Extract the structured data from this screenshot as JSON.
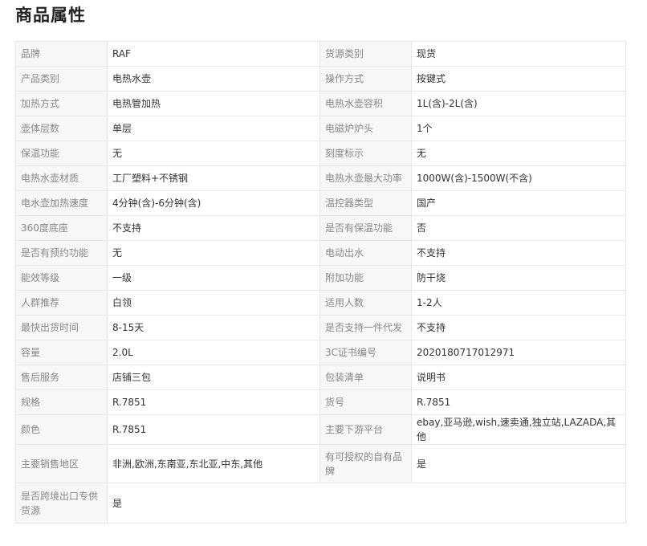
{
  "title": "商品属性",
  "rows": [
    {
      "k1": "品牌",
      "v1": "RAF",
      "k2": "货源类别",
      "v2": "现货"
    },
    {
      "k1": "产品类别",
      "v1": "电热水壶",
      "k2": "操作方式",
      "v2": "按键式"
    },
    {
      "k1": "加热方式",
      "v1": "电热管加热",
      "k2": "电热水壶容积",
      "v2": "1L(含)-2L(含)"
    },
    {
      "k1": "壶体层数",
      "v1": "单层",
      "k2": "电磁炉炉头",
      "v2": "1个"
    },
    {
      "k1": "保温功能",
      "v1": "无",
      "k2": "刻度标示",
      "v2": "无"
    },
    {
      "k1": "电热水壶材质",
      "v1": "工厂塑料+不锈钢",
      "k2": "电热水壶最大功率",
      "v2": "1000W(含)-1500W(不含)"
    },
    {
      "k1": "电水壶加热速度",
      "v1": "4分钟(含)-6分钟(含)",
      "k2": "温控器类型",
      "v2": "国产"
    },
    {
      "k1": "360度底座",
      "v1": "不支持",
      "k2": "是否有保温功能",
      "v2": "否"
    },
    {
      "k1": "是否有预约功能",
      "v1": "无",
      "k2": "电动出水",
      "v2": "不支持"
    },
    {
      "k1": "能效等级",
      "v1": "一级",
      "k2": "附加功能",
      "v2": "防干烧"
    },
    {
      "k1": "人群推荐",
      "v1": "白领",
      "k2": "适用人数",
      "v2": "1-2人"
    },
    {
      "k1": "最快出货时间",
      "v1": "8-15天",
      "k2": "是否支持一件代发",
      "v2": "不支持"
    },
    {
      "k1": "容量",
      "v1": "2.0L",
      "k2": "3C证书编号",
      "v2": "2020180717012971"
    },
    {
      "k1": "售后服务",
      "v1": "店铺三包",
      "k2": "包装清单",
      "v2": "说明书"
    },
    {
      "k1": "规格",
      "v1": "R.7851",
      "k2": "货号",
      "v2": "R.7851"
    },
    {
      "k1": "颜色",
      "v1": "R.7851",
      "k2": "主要下游平台",
      "v2": "ebay,亚马逊,wish,速卖通,独立站,LAZADA,其他"
    },
    {
      "k1": "主要销售地区",
      "v1": "非洲,欧洲,东南亚,东北亚,中东,其他",
      "k2": "有可授权的自有品牌",
      "v2": "是"
    }
  ],
  "last_row": {
    "k1": "是否跨境出口专供货源",
    "v1": "是"
  }
}
